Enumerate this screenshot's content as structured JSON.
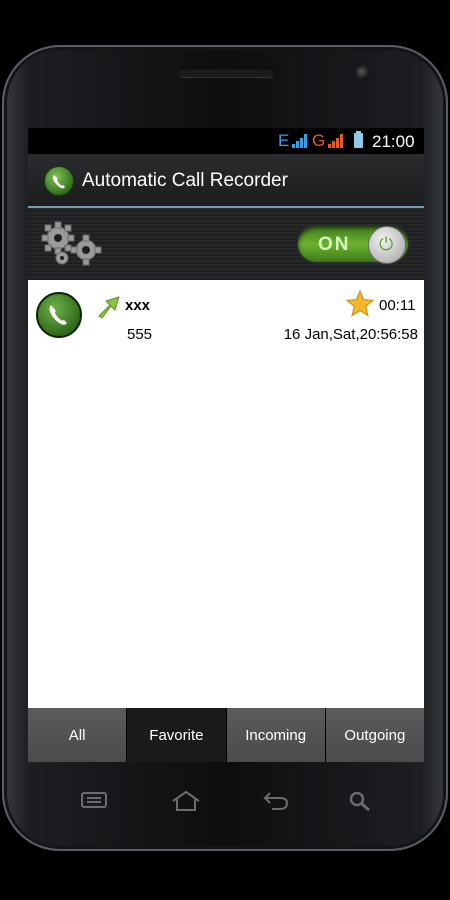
{
  "status_bar": {
    "network_e": "E",
    "network_g": "G",
    "time": "21:00"
  },
  "app": {
    "title": "Automatic Call Recorder"
  },
  "toolbar": {
    "toggle_label": "ON",
    "toggle_state": true,
    "settings_icon": "gears-icon",
    "accent_color": "#6bb22c"
  },
  "calls": [
    {
      "name": "xxx",
      "number": "555",
      "duration": "00:11",
      "datetime": "16 Jan,Sat,20:56:58",
      "direction": "outgoing",
      "favorite": true
    }
  ],
  "tabs": [
    {
      "label": "All",
      "active": false
    },
    {
      "label": "Favorite",
      "active": true
    },
    {
      "label": "Incoming",
      "active": false
    },
    {
      "label": "Outgoing",
      "active": false
    }
  ],
  "hardware_nav": [
    "menu-icon",
    "home-icon",
    "back-icon",
    "search-icon"
  ]
}
